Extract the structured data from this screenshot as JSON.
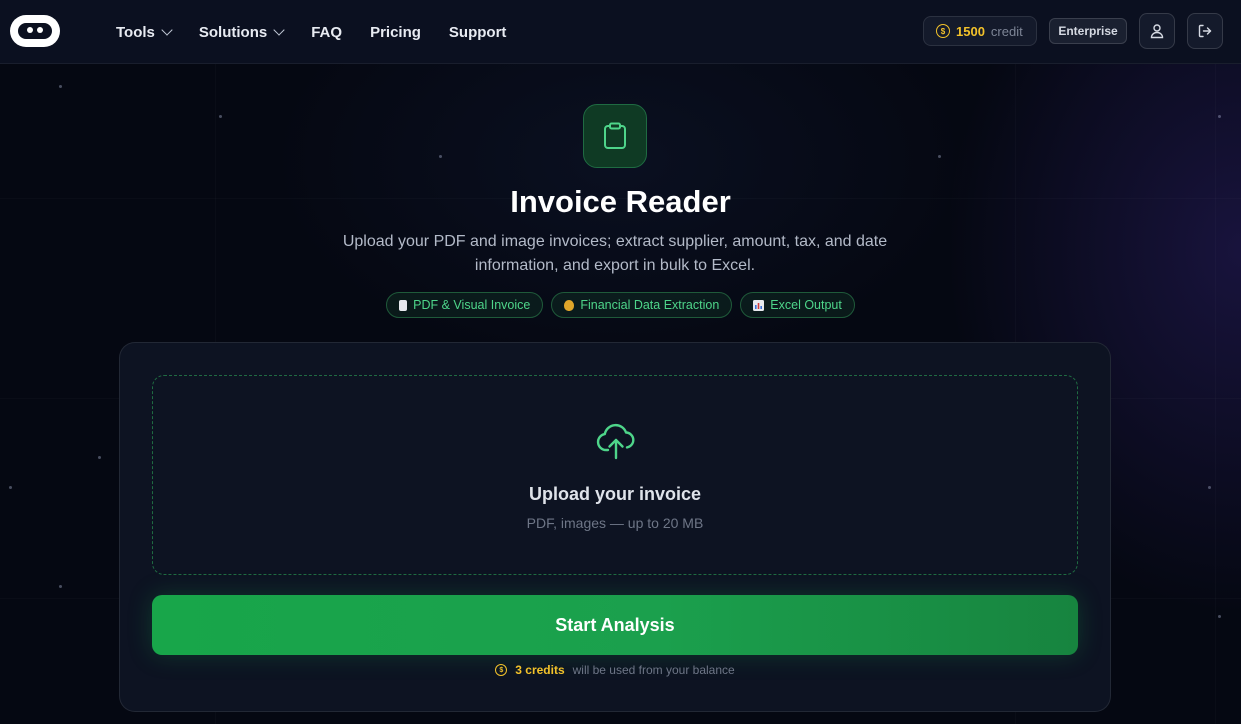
{
  "header": {
    "nav": [
      {
        "label": "Tools",
        "dropdown": true
      },
      {
        "label": "Solutions",
        "dropdown": true
      },
      {
        "label": "FAQ",
        "dropdown": false
      },
      {
        "label": "Pricing",
        "dropdown": false
      },
      {
        "label": "Support",
        "dropdown": false
      }
    ],
    "credit_amount": "1500",
    "credit_unit": "credit",
    "enterprise_label": "Enterprise",
    "icons": [
      "user-icon",
      "logout-icon"
    ]
  },
  "hero": {
    "icon": "clipboard-icon",
    "title": "Invoice Reader",
    "subtitle": "Upload your PDF and image invoices; extract supplier, amount, tax, and date information, and export in bulk to Excel.",
    "tags": [
      {
        "icon": "document-icon",
        "label": "PDF & Visual Invoice"
      },
      {
        "icon": "money-bag-icon",
        "label": "Financial Data Extraction"
      },
      {
        "icon": "bar-chart-icon",
        "label": "Excel Output"
      }
    ]
  },
  "upload": {
    "icon": "cloud-upload-icon",
    "title": "Upload your invoice",
    "subtitle": "PDF, images — up to 20 MB"
  },
  "action": {
    "button_label": "Start Analysis",
    "cost_amount": "3 credits",
    "cost_note": "will be used from your balance"
  },
  "colors": {
    "accent_green": "#1ba04d",
    "credit_yellow": "#f3c22a",
    "background": "#050812"
  }
}
